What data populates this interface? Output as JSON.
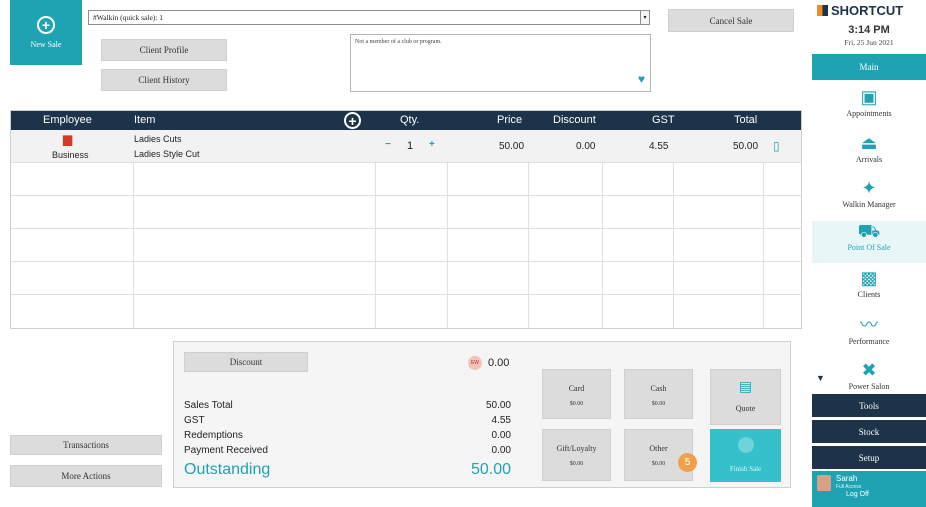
{
  "header": {
    "new_sale_label": "New Sale",
    "client_value": "#Walkin (quick sale): 1",
    "client_profile_label": "Client Profile",
    "client_history_label": "Client History",
    "member_note": "Not a member of a club or program.",
    "cancel_sale_label": "Cancel Sale"
  },
  "table": {
    "columns": [
      "Employee",
      "Item",
      "Qty.",
      "Price",
      "Discount",
      "GST",
      "Total"
    ],
    "rows": [
      {
        "employee": "Business",
        "item_line1": "Ladies Cuts",
        "item_line2": "Ladies Style Cut",
        "qty_minus": "−",
        "qty": "1",
        "qty_plus": "+",
        "price": "50.00",
        "discount": "0.00",
        "gst": "4.55",
        "total": "50.00"
      }
    ]
  },
  "totals": {
    "discount_label": "Discount",
    "badge": "EW",
    "discount_value": "0.00",
    "sales_total_label": "Sales Total",
    "sales_total": "50.00",
    "gst_label": "GST",
    "gst": "4.55",
    "redemptions_label": "Redemptions",
    "redemptions": "0.00",
    "payment_label": "Payment Received",
    "payment": "0.00",
    "outstanding_label": "Outstanding",
    "outstanding": "50.00"
  },
  "payments": {
    "card_label": "Card",
    "card_value": "$0.00",
    "cash_label": "Cash",
    "cash_value": "$0.00",
    "quote_label": "Quote",
    "gift_label": "Gift/Loyalty",
    "gift_value": "$0.00",
    "other_label": "Other",
    "other_value": "$0.00",
    "finish_label": "Finish Sale",
    "step_badge": "5"
  },
  "left_actions": {
    "transactions_label": "Transactions",
    "more_actions_label": "More Actions"
  },
  "sidebar": {
    "brand": "SHORTCUT",
    "time": "3:14 PM",
    "date": "Fri, 25 Jun 2021",
    "main_label": "Main",
    "items": [
      {
        "label": "Appointments",
        "icon": "calendar-icon"
      },
      {
        "label": "Arrivals",
        "icon": "bell-icon"
      },
      {
        "label": "Walkin Manager",
        "icon": "walking-person-icon"
      },
      {
        "label": "Point Of Sale",
        "icon": "cart-icon"
      },
      {
        "label": "Clients",
        "icon": "client-card-icon"
      },
      {
        "label": "Performance",
        "icon": "trend-line-icon"
      },
      {
        "label": "Power Salon",
        "icon": "dumbbell-icon"
      }
    ],
    "tools_label": "Tools",
    "stock_label": "Stock",
    "setup_label": "Setup",
    "user_name": "Sarah",
    "user_access": "Full Access",
    "logoff_label": "Log Off"
  },
  "colors": {
    "accent": "#1fa3b3",
    "header_dark": "#1d3349",
    "outstanding": "#1fa3b3",
    "badge": "#f0a04b"
  }
}
